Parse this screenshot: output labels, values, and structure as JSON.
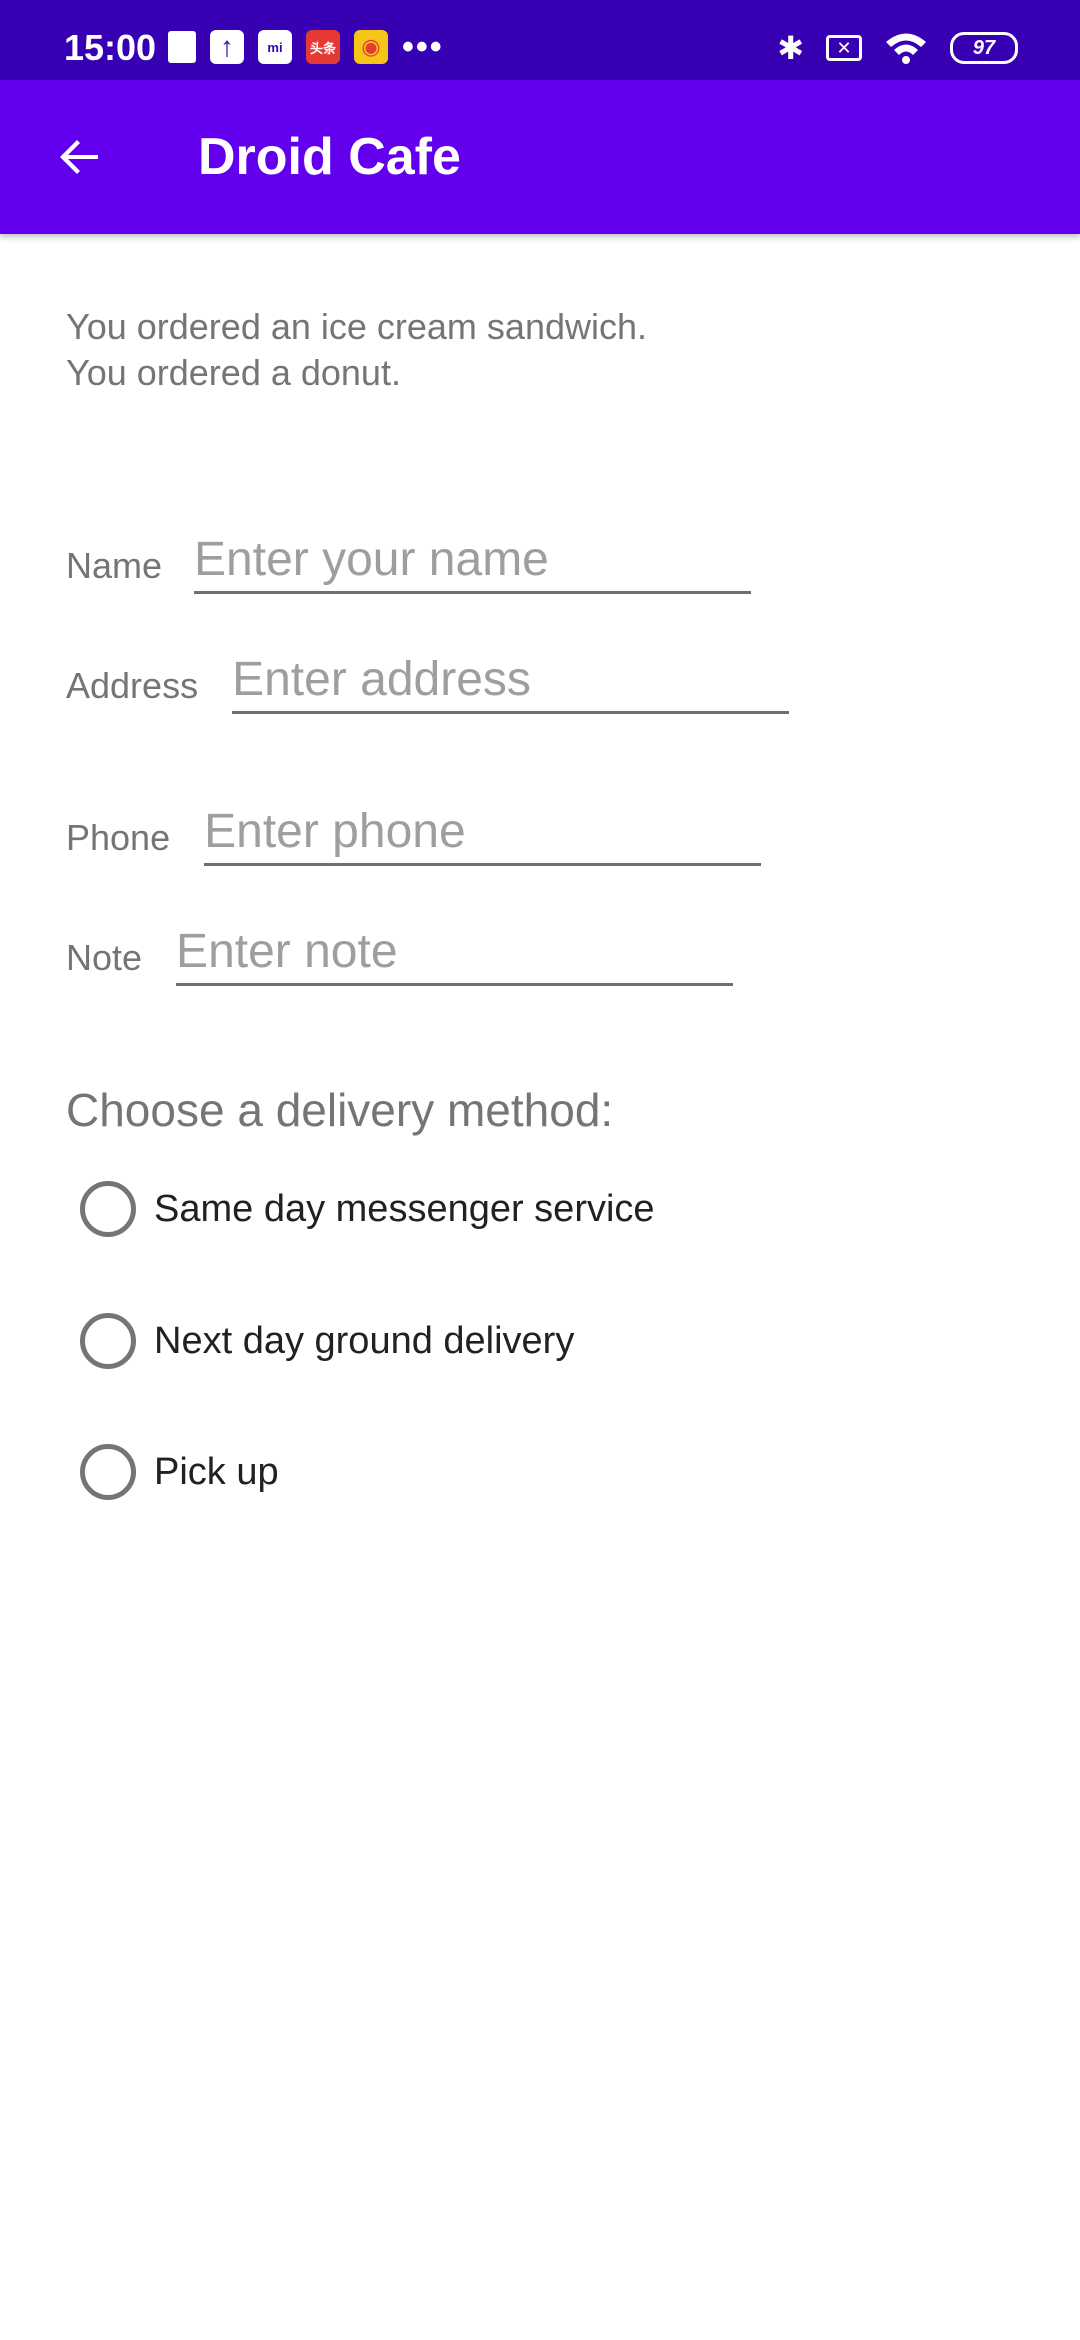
{
  "status_bar": {
    "time": "15:00",
    "left_icons": [
      "trash-icon",
      "upload-icon",
      "mi-store-icon",
      "toutiao-icon",
      "weibo-icon"
    ],
    "mi_text": "mi",
    "toutiao_text": "头条",
    "more": "•••",
    "bluetooth": "✱",
    "sim_status": "✕",
    "battery": "97"
  },
  "app_bar": {
    "title": "Droid Cafe",
    "background": "#6200ee"
  },
  "order_summary": "You ordered an ice cream sandwich.\nYou ordered a donut.",
  "form": {
    "name": {
      "label": "Name",
      "placeholder": "Enter your name",
      "value": ""
    },
    "address": {
      "label": "Address",
      "placeholder": "Enter address",
      "value": ""
    },
    "phone": {
      "label": "Phone",
      "placeholder": "Enter phone",
      "value": ""
    },
    "note": {
      "label": "Note",
      "placeholder": "Enter note",
      "value": ""
    }
  },
  "delivery": {
    "heading": "Choose a delivery method:",
    "options": [
      {
        "label": "Same day messenger service",
        "selected": false
      },
      {
        "label": "Next day ground delivery",
        "selected": false
      },
      {
        "label": "Pick up",
        "selected": false
      }
    ]
  }
}
